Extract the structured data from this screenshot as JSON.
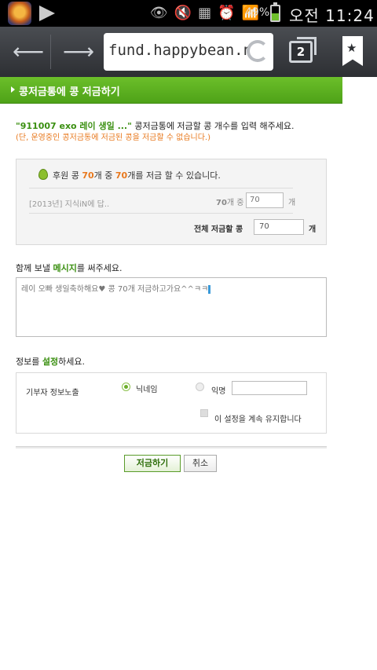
{
  "status_bar": {
    "battery_pct": "49%",
    "battery_level": 0.49,
    "clock": "오전 11:24"
  },
  "browser": {
    "url": "fund.happybean.na",
    "tab_count": "2"
  },
  "page": {
    "header_title": "콩저금통에 콩 저금하기",
    "intro": {
      "fund_name": "\"911007 exo 레이 생일 ...\"",
      "instruction": " 콩저금통에 저금할 콩 개수를 입력 해주세요.",
      "warning": "(단, 운영중인 콩저금통에 저금된 콩을 저금할 수 없습니다.)"
    },
    "beans": {
      "prefix": "후원 콩 ",
      "available": "70",
      "mid": "개 중 ",
      "max": "70",
      "suffix": "개를 저금 할 수 있습니다.",
      "item_title": "[2013년] 지식iN에 답..",
      "item_count_label_num": "70",
      "item_count_label_txt": "개 중",
      "item_value": "70",
      "unit": "개",
      "total_label": "전체 저금할 콩",
      "total_value": "70",
      "total_unit": "개"
    },
    "message": {
      "label_prefix": "함께 보낼 ",
      "label_highlight": "메시지",
      "label_suffix": "를 써주세요.",
      "text": "레이 오빠 생일축하해요♥ 콩 70개 저금하고가요^^ㅋㅋ"
    },
    "settings": {
      "label_prefix": "정보를 ",
      "label_highlight": "설정",
      "label_suffix": "하세요.",
      "donor_label": "기부자 정보노출",
      "option_nickname": "닉네임",
      "option_anonymous": "익명",
      "keep_setting": "이 설정을 계속 유지합니다"
    },
    "buttons": {
      "save": "저금하기",
      "cancel": "취소"
    }
  },
  "colors": {
    "header_green": "#5cb01f",
    "accent_orange": "#e8791e",
    "text_green": "#3a8f10"
  }
}
